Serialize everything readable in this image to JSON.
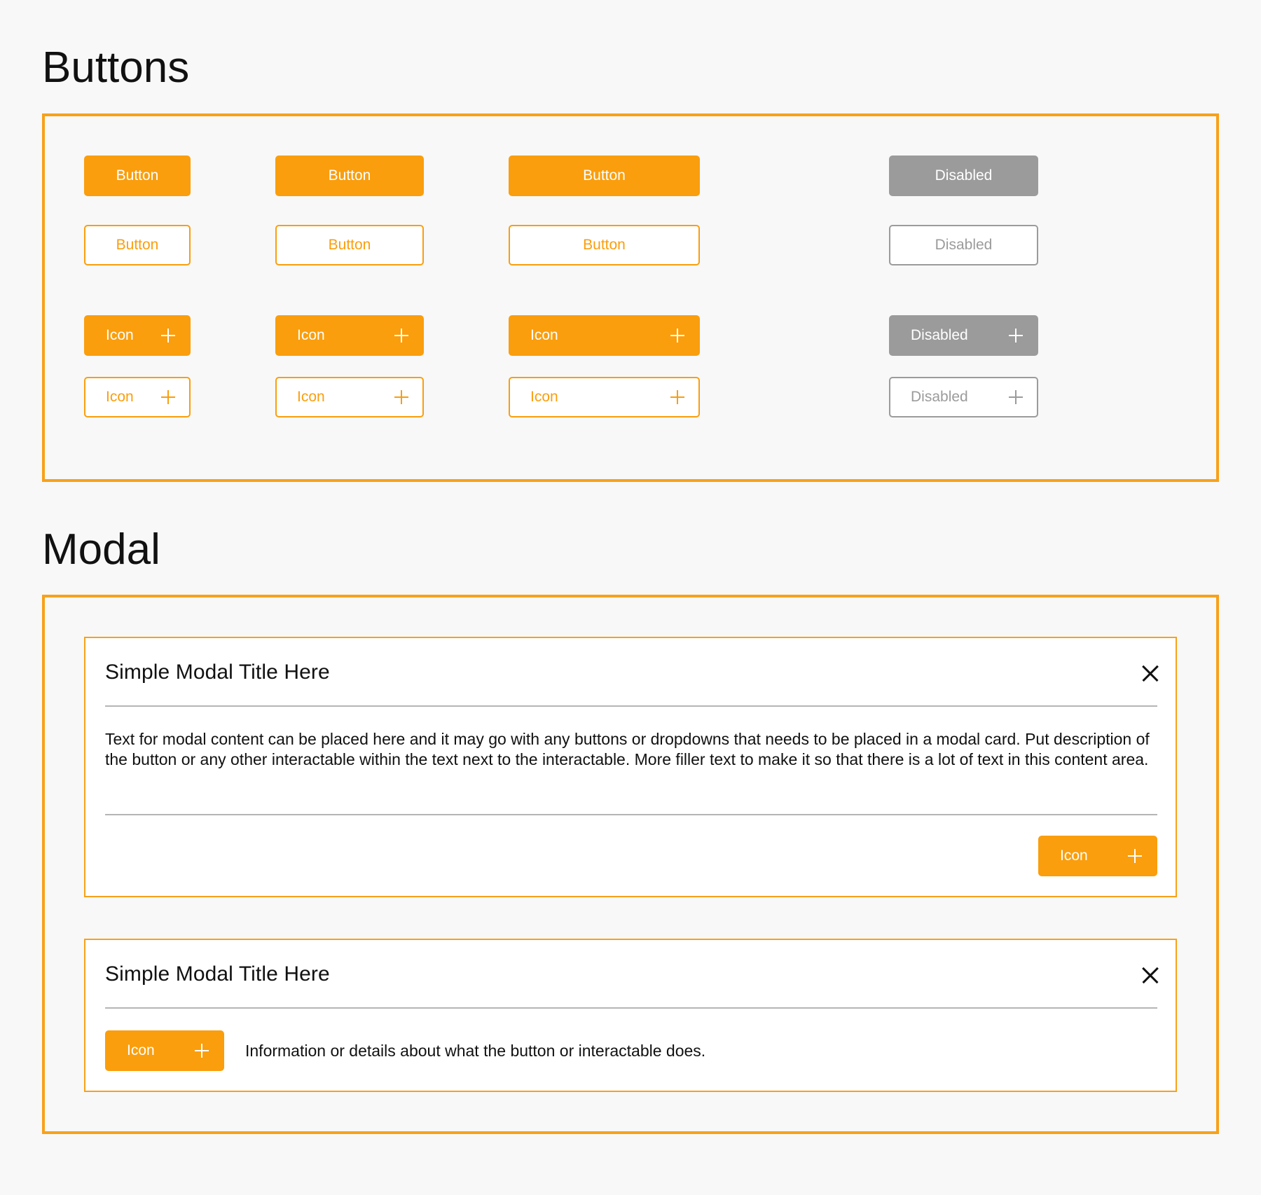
{
  "buttons_section": {
    "heading": "Buttons",
    "rows": {
      "solid": [
        "Button",
        "Button",
        "Button",
        "Disabled"
      ],
      "outline": [
        "Button",
        "Button",
        "Button",
        "Disabled"
      ],
      "solid_icon": [
        "Icon",
        "Icon",
        "Icon",
        "Disabled"
      ],
      "outline_icon": [
        "Icon",
        "Icon",
        "Icon",
        "Disabled"
      ]
    },
    "icon": "plus-icon"
  },
  "modal_section": {
    "heading": "Modal",
    "modal_1": {
      "title": "Simple Modal Title Here",
      "body": "Text for modal content can be placed here and it may go with any buttons or dropdowns that needs to be placed in a modal card. Put description of the button or any other interactable within the text next to the interactable. More filler text to make it so that there is a lot of text in this content area.",
      "button_label": "Icon",
      "close_icon": "close-icon"
    },
    "modal_2": {
      "title": "Simple Modal Title Here",
      "button_label": "Icon",
      "description": "Information or details about what the button or interactable does.",
      "close_icon": "close-icon"
    }
  },
  "colors": {
    "accent": "#fa9e0d",
    "border": "#f7a11a",
    "disabled": "#9b9b9b",
    "background": "#f8f8f8"
  }
}
